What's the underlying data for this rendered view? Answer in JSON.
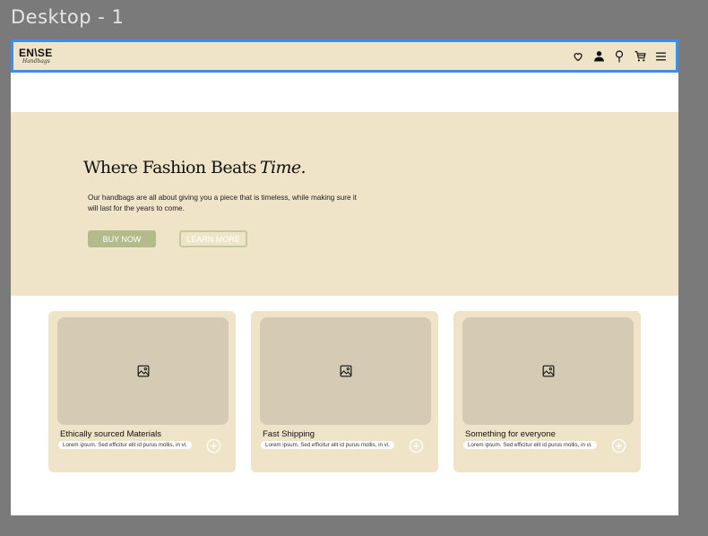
{
  "frame": {
    "title": "Desktop - 1"
  },
  "navbar": {
    "logo_main": "EN\\SE",
    "logo_sub": "Handbags",
    "icons": [
      "heart-icon",
      "user-icon",
      "location-pin-icon",
      "cart-icon",
      "menu-icon"
    ]
  },
  "hero": {
    "title": "Where Fashion Beats",
    "title_accent": "Time.",
    "description": "Our handbags are all about giving you a piece that is timeless, while making sure it will last for the years to come.",
    "buy_label": "BUY NOW",
    "learn_label": "LEARN MORE"
  },
  "cards": [
    {
      "title": "Ethically sourced Materials",
      "desc": "Lorem ipsum. Sed efficitur elit id purus mollis, in vi."
    },
    {
      "title": "Fast Shipping",
      "desc": "Lorem ipsum. Sed efficitur elit id purus mollis, in vi."
    },
    {
      "title": "Something for everyone",
      "desc": "Lorem ipsum. Sed efficitur elit id purus mollis, in vi."
    }
  ],
  "colors": {
    "background": "#7a7a7a",
    "cream": "#f0e4c8",
    "image_placeholder": "#d5cab3",
    "accent_green": "#b3bb8a",
    "selection_blue": "#3b8ff0"
  }
}
